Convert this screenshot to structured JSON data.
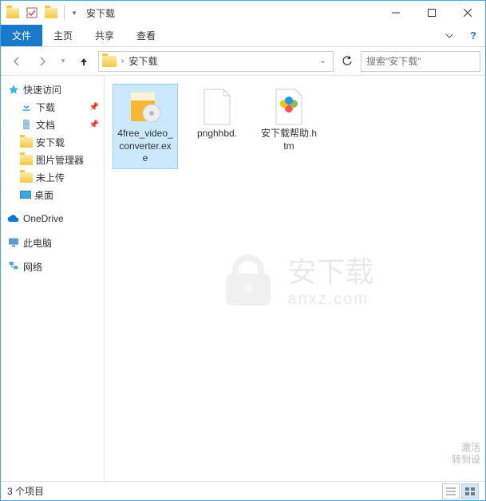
{
  "window": {
    "title": "安下载"
  },
  "ribbon": {
    "file": "文件",
    "home": "主页",
    "share": "共享",
    "view": "查看"
  },
  "address": {
    "current": "安下载"
  },
  "search": {
    "placeholder": "搜索\"安下载\""
  },
  "sidebar": {
    "quickaccess": "快速访问",
    "downloads": "下载",
    "documents": "文档",
    "anxiazai": "安下载",
    "picmgr": "图片管理器",
    "notuploaded": "未上传",
    "desktop": "桌面",
    "onedrive": "OneDrive",
    "thispc": "此电脑",
    "network": "网络"
  },
  "files": [
    {
      "name": "4free_video_converter.exe",
      "type": "installer"
    },
    {
      "name": "pnghhbd.",
      "type": "blank"
    },
    {
      "name": "安下载帮助.htm",
      "type": "htm"
    }
  ],
  "status": {
    "count": "3 个项目"
  },
  "watermark": {
    "text1": "安下载",
    "text2": "anxz.com"
  },
  "activate": {
    "line1": "激活",
    "line2": "转到设"
  }
}
